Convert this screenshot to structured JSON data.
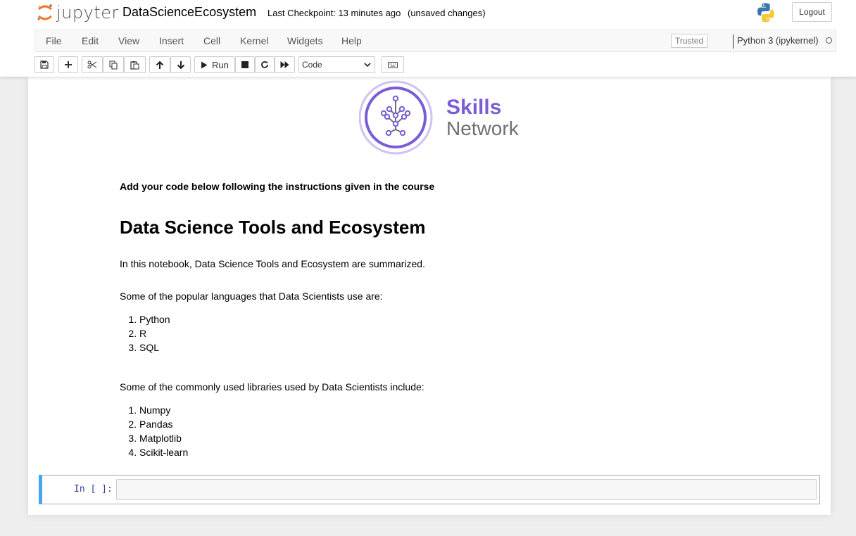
{
  "header": {
    "logo_text": "jupyter",
    "notebook_name": "DataScienceEcosystem",
    "checkpoint": "Last Checkpoint: 13 minutes ago",
    "autosave_status": "(unsaved changes)",
    "logout_label": "Logout"
  },
  "menubar": {
    "items": [
      "File",
      "Edit",
      "View",
      "Insert",
      "Cell",
      "Kernel",
      "Widgets",
      "Help"
    ],
    "trusted_label": "Trusted",
    "kernel_name": "Python 3 (ipykernel)"
  },
  "toolbar": {
    "run_label": "Run",
    "cell_type": "Code",
    "icons": [
      "save-icon",
      "plus-icon",
      "cut-icon",
      "copy-icon",
      "paste-icon",
      "arrow-up-icon",
      "arrow-down-icon",
      "run-icon",
      "stop-icon",
      "restart-icon",
      "fast-forward-icon",
      "keyboard-icon"
    ]
  },
  "notebook": {
    "logo": {
      "line1": "Skills",
      "line2": "Network",
      "color_primary": "#7c5cd6",
      "color_secondary": "#707070"
    },
    "instruction": "Add your code below following the instructions given in the course",
    "title": "Data Science Tools and Ecosystem",
    "intro": "In this notebook, Data Science Tools and Ecosystem are summarized.",
    "languages_heading": "Some of the popular languages that Data Scientists use are:",
    "languages": [
      "Python",
      "R",
      "SQL"
    ],
    "libraries_heading": "Some of the commonly used libraries used by Data Scientists include:",
    "libraries": [
      "Numpy",
      "Pandas",
      "Matplotlib",
      "Scikit-learn"
    ],
    "code_cell": {
      "prompt": "In [ ]:",
      "content": ""
    }
  },
  "colors": {
    "page_bg": "#eeeeee",
    "selected_cell_bar": "#42a5f5",
    "prompt": "#303f9f",
    "jupyter_orange": "#f37726"
  }
}
